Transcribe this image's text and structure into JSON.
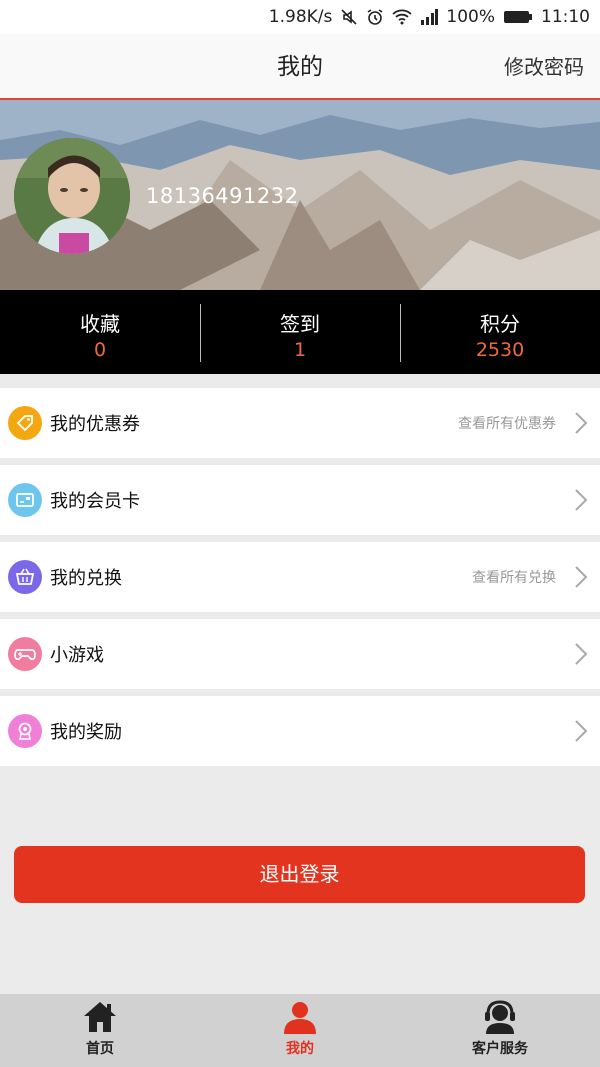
{
  "status_bar": {
    "speed": "1.98K/s",
    "battery": "100%",
    "time": "11:10"
  },
  "header": {
    "title": "我的",
    "change_password": "修改密码"
  },
  "profile": {
    "phone": "18136491232"
  },
  "stats": [
    {
      "label": "收藏",
      "value": "0"
    },
    {
      "label": "签到",
      "value": "1"
    },
    {
      "label": "积分",
      "value": "2530"
    }
  ],
  "menu": [
    {
      "label": "我的优惠券",
      "hint": "查看所有优惠券",
      "icon": "coupon-icon",
      "color": "#f5a712"
    },
    {
      "label": "我的会员卡",
      "hint": "",
      "icon": "card-icon",
      "color": "#6ec6ef"
    },
    {
      "label": "我的兑换",
      "hint": "查看所有兑换",
      "icon": "basket-icon",
      "color": "#7b68e8"
    },
    {
      "label": "小游戏",
      "hint": "",
      "icon": "gamepad-icon",
      "color": "#f07d9f"
    },
    {
      "label": "我的奖励",
      "hint": "",
      "icon": "award-icon",
      "color": "#f07fd8"
    }
  ],
  "logout_label": "退出登录",
  "tabs": [
    {
      "label": "首页",
      "icon": "home-icon"
    },
    {
      "label": "我的",
      "icon": "user-icon"
    },
    {
      "label": "客户服务",
      "icon": "headset-icon"
    }
  ],
  "colors": {
    "accent": "#e3341f",
    "stat_value": "#ee6a3c"
  }
}
